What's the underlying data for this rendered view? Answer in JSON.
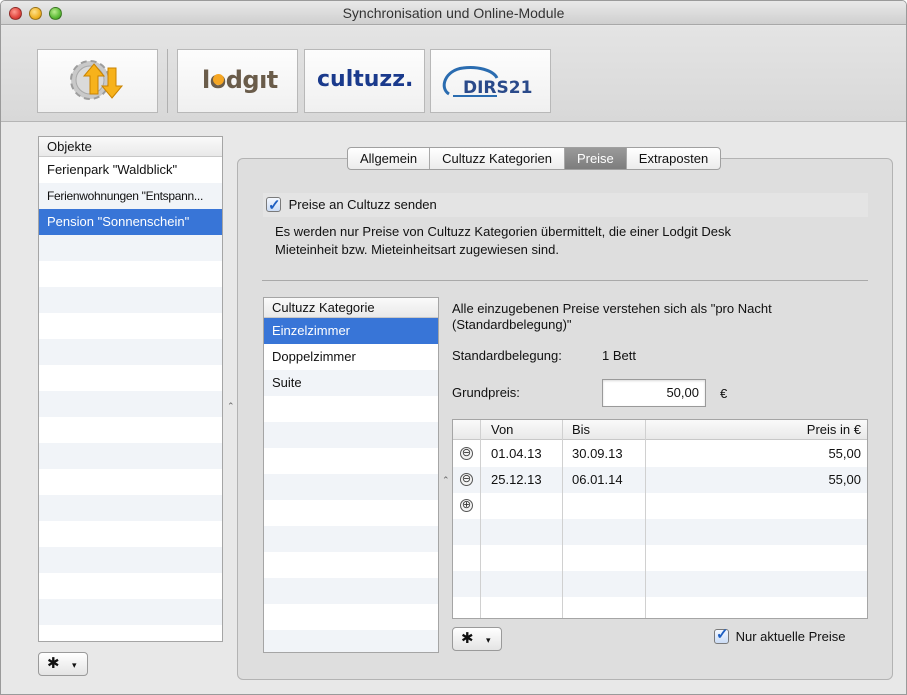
{
  "window": {
    "title": "Synchronisation und Online-Module"
  },
  "toolbar": {
    "buttons": [
      {
        "name": "sync",
        "label": ""
      },
      {
        "name": "lodgit",
        "label": "lodgıt"
      },
      {
        "name": "cultuzz",
        "label": "cultuzz."
      },
      {
        "name": "dirs21",
        "label": "DIRS21"
      }
    ]
  },
  "sidebar": {
    "header": "Objekte",
    "items": [
      {
        "label": "Ferienpark \"Waldblick\""
      },
      {
        "label": "Ferienwohnungen \"Entspann..."
      },
      {
        "label": "Pension \"Sonnenschein\"",
        "selected": true
      }
    ]
  },
  "tabs": [
    {
      "label": "Allgemein"
    },
    {
      "label": "Cultuzz Kategorien"
    },
    {
      "label": "Preise",
      "active": true
    },
    {
      "label": "Extraposten"
    }
  ],
  "preise": {
    "send_checkbox_label": "Preise an Cultuzz senden",
    "send_checked": true,
    "note_line1": "Es werden nur Preise von Cultuzz Kategorien übermittelt, die einer Lodgit Desk",
    "note_line2": "Mieteinheit bzw. Mieteinheitsart zugewiesen sind.",
    "category_header": "Cultuzz Kategorie",
    "categories": [
      {
        "label": "Einzelzimmer",
        "selected": true
      },
      {
        "label": "Doppelzimmer"
      },
      {
        "label": "Suite"
      }
    ],
    "info_line1": "Alle einzugebenen Preise verstehen sich als \"pro Nacht",
    "info_line2": "(Standardbelegung)\"",
    "standard_label": "Standardbelegung:",
    "standard_value": "1 Bett",
    "grundpreis_label": "Grundpreis:",
    "grundpreis_value": "50,00",
    "currency": "€",
    "table_headers": {
      "von": "Von",
      "bis": "Bis",
      "preis": "Preis in €"
    },
    "rows": [
      {
        "von": "01.04.13",
        "bis": "30.09.13",
        "preis": "55,00"
      },
      {
        "von": "25.12.13",
        "bis": "06.01.14",
        "preis": "55,00"
      }
    ],
    "only_current_label": "Nur aktuelle Preise",
    "only_current_checked": true
  },
  "icons": {
    "remove": "⊖",
    "add": "⊕",
    "gear": "✱",
    "caret": "▾"
  },
  "colors": {
    "selection": "#3875d7",
    "lodgit_dot": "#f5a623",
    "cultuzz_blue": "#1a3a8c",
    "dirs_blue": "#2a6cb0"
  }
}
